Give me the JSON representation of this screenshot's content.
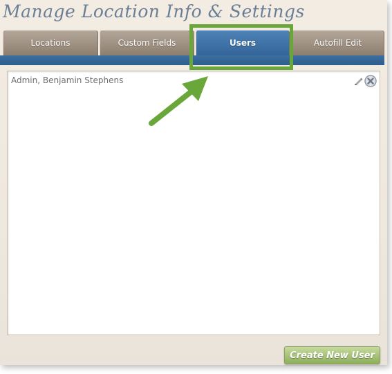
{
  "page": {
    "title": "Manage Location Info & Settings"
  },
  "tabs": [
    {
      "label": "Locations",
      "active": false
    },
    {
      "label": "Custom Fields",
      "active": false
    },
    {
      "label": "Users",
      "active": true
    },
    {
      "label": "Autofill Edit",
      "active": false
    }
  ],
  "users": [
    {
      "name": "Admin, Benjamin Stephens",
      "actions": [
        "pencil-icon",
        "delete-icon"
      ]
    }
  ],
  "actions": {
    "create_user_label": "Create New User"
  },
  "colors": {
    "active_tab": "#3f72a6",
    "inactive_tab": "#9f9182",
    "highlight_annotation": "#6aa73a",
    "create_button": "#a9c47a"
  }
}
